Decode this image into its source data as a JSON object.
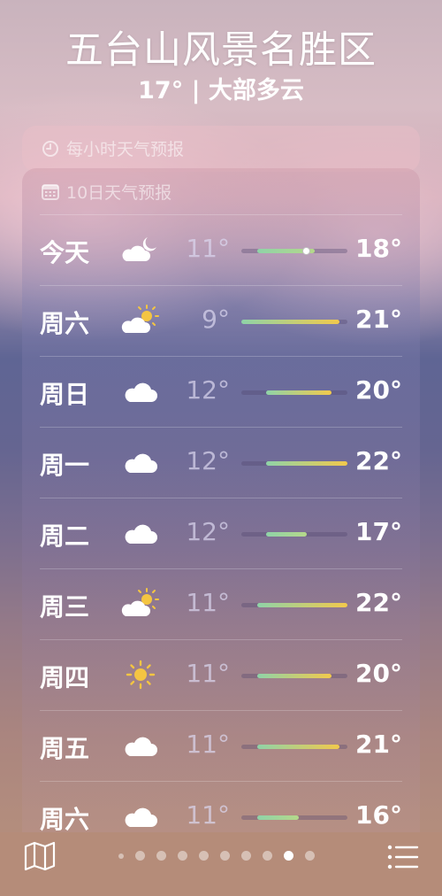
{
  "header": {
    "location": "五台山风景名胜区",
    "summary": "17° | 大部多云"
  },
  "hourly_forecast": {
    "title": "每小时天气预报",
    "icon": "clock-icon"
  },
  "daily_forecast": {
    "title": "10日天气预报",
    "icon": "calendar-icon",
    "days": [
      {
        "day": "今天",
        "icon": "partly-cloudy-night-icon",
        "low": "11°",
        "high": "18°",
        "current_temp": 17
      },
      {
        "day": "周六",
        "icon": "partly-sunny-icon",
        "low": "9°",
        "high": "21°"
      },
      {
        "day": "周日",
        "icon": "cloud-icon",
        "low": "12°",
        "high": "20°"
      },
      {
        "day": "周一",
        "icon": "cloud-icon",
        "low": "12°",
        "high": "22°"
      },
      {
        "day": "周二",
        "icon": "cloud-icon",
        "low": "12°",
        "high": "17°"
      },
      {
        "day": "周三",
        "icon": "partly-sunny-icon",
        "low": "11°",
        "high": "22°"
      },
      {
        "day": "周四",
        "icon": "sun-icon",
        "low": "11°",
        "high": "20°"
      },
      {
        "day": "周五",
        "icon": "cloud-icon",
        "low": "11°",
        "high": "21°"
      },
      {
        "day": "周六",
        "icon": "cloud-icon",
        "low": "11°",
        "high": "16°"
      }
    ]
  },
  "range": {
    "min": 9,
    "max": 22
  },
  "bottom_bar": {
    "map_icon": "map-icon",
    "list_icon": "list-icon",
    "page_count": 10,
    "current_page": 9
  }
}
